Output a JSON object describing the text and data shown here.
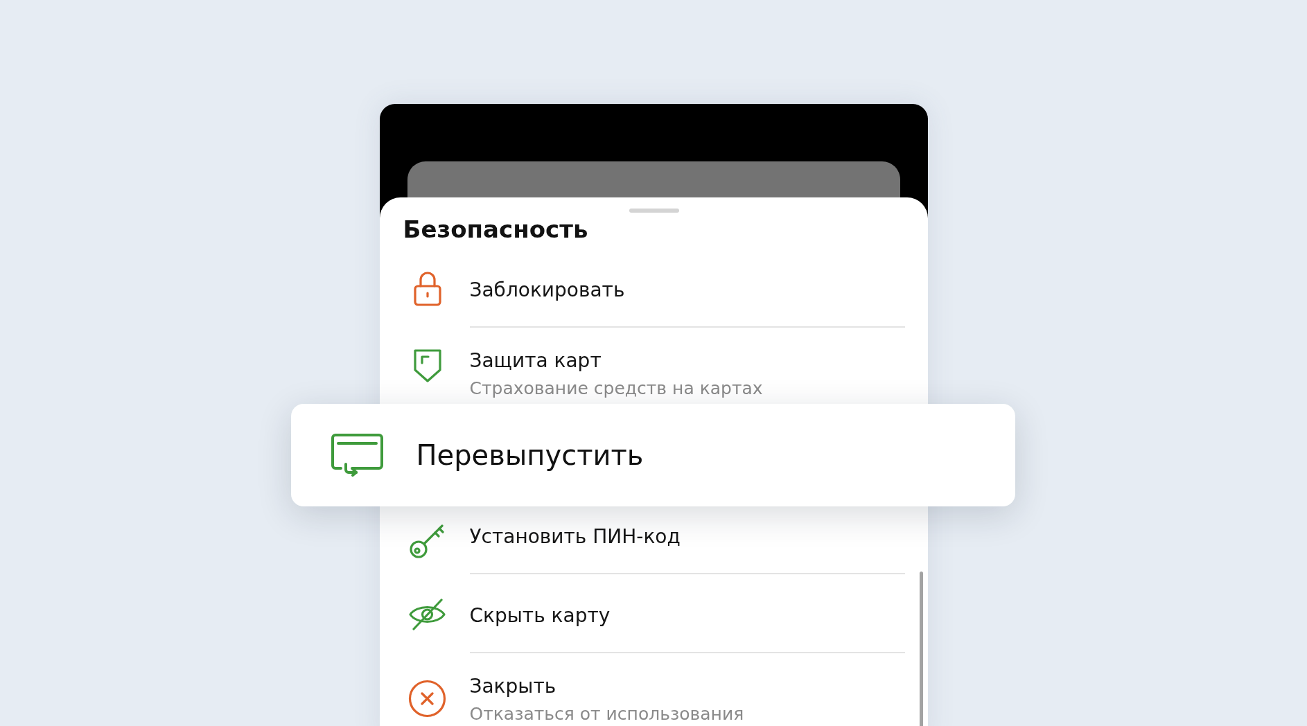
{
  "menu": {
    "title": "Безопасность",
    "items": [
      {
        "label": "Заблокировать",
        "highlighted": false
      },
      {
        "label": "Защита карт",
        "subtitle": "Страхование средств на картах",
        "highlighted": false
      },
      {
        "label": "Перевыпустить",
        "highlighted": true
      },
      {
        "label": "Установить ПИН-код",
        "highlighted": false
      },
      {
        "label": "Скрыть карту",
        "highlighted": false
      },
      {
        "label": "Закрыть",
        "subtitle": "Отказаться от использования",
        "highlighted": false
      }
    ]
  }
}
